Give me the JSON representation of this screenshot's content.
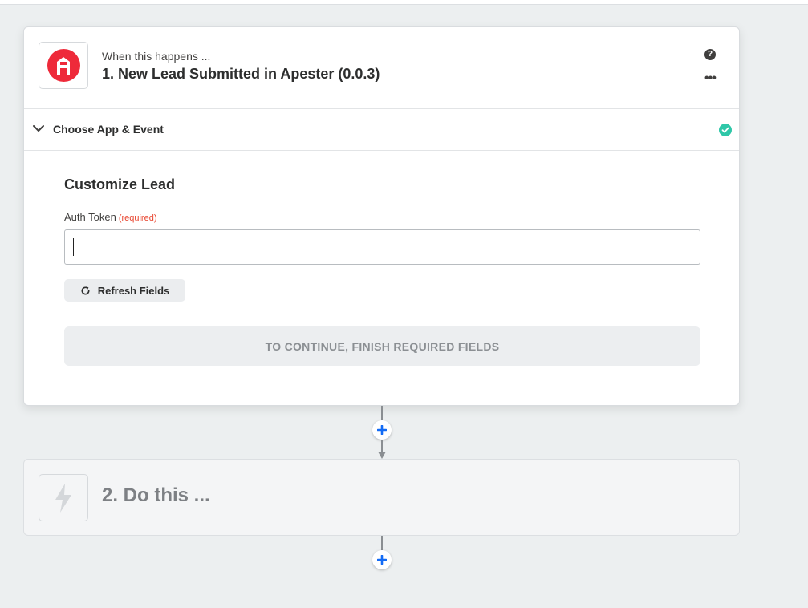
{
  "step1": {
    "subtitle": "When this happens ...",
    "title": "1. New Lead Submitted in Apester (0.0.3)",
    "help_glyph": "?",
    "more_glyph": "•••",
    "section": {
      "label": "Choose App & Event"
    },
    "form": {
      "title": "Customize Lead",
      "field_label": "Auth Token",
      "field_required": "(required)",
      "field_value": "",
      "refresh_label": "Refresh Fields",
      "continue_label": "TO CONTINUE, FINISH REQUIRED FIELDS"
    }
  },
  "step2": {
    "title": "2. Do this ..."
  },
  "colors": {
    "apester_red": "#ee2a3a",
    "success_green": "#2fc7a8",
    "add_blue": "#136bf5",
    "required_red": "#e8452f"
  },
  "icons": {
    "app": "apester-logo-icon",
    "help": "help-circle-icon",
    "more": "more-dots-icon",
    "collapse": "chevron-down-icon",
    "complete": "check-circle-icon",
    "refresh": "refresh-icon",
    "add": "plus-icon",
    "action": "lightning-bolt-icon"
  }
}
